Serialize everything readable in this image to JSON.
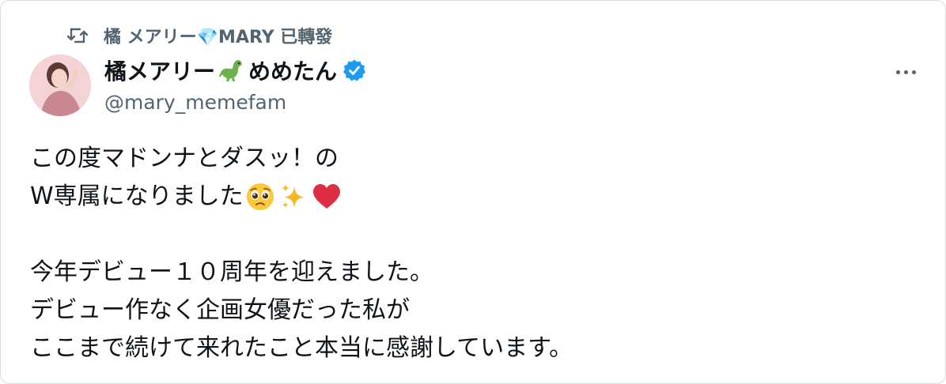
{
  "retweet": {
    "label": "橘 メアリー💎MARY 已轉發",
    "icon": "retweet-icon"
  },
  "author": {
    "name_part1": "橘メアリー",
    "name_emoji": "dinosaur-emoji",
    "name_part2": "めめたん",
    "verified_icon": "verified-badge-icon",
    "handle": "@mary_memefam"
  },
  "tweet": {
    "line1": "この度マドンナとダスッ！の",
    "line2": "W専属になりました",
    "line2_emojis": [
      "pleading-face-emoji",
      "sparkles-emoji",
      "red-heart-emoji"
    ],
    "line4": "今年デビュー１０周年を迎えました。",
    "line5": "デビュー作なく企画女優だった私が",
    "line6": "ここまで続けて来れたこと本当に感謝しています。"
  },
  "colors": {
    "text_primary": "#0f1419",
    "text_secondary": "#536471",
    "verified_blue": "#1d9bf0",
    "border": "#d9dde1"
  }
}
